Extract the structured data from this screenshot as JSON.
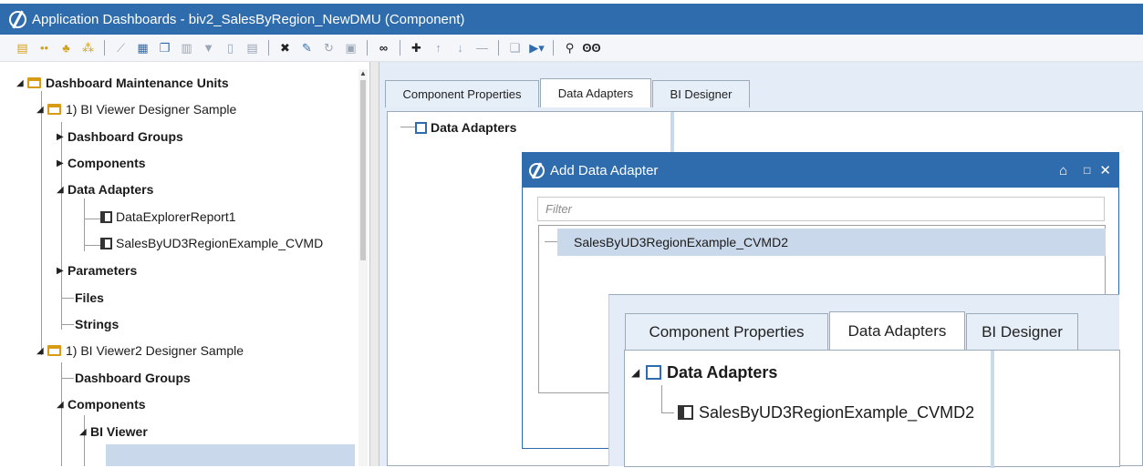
{
  "window": {
    "title": "Application Dashboards - biv2_SalesByRegion_NewDMU (Component)"
  },
  "toolbar": {
    "icons": [
      "calendar-icon",
      "dots-icon",
      "group-icon",
      "add-group-icon",
      "chart-icon",
      "grid-icon",
      "window-icon",
      "columns-icon",
      "filter-icon",
      "document-icon",
      "list-icon",
      "delete-icon",
      "edit-icon",
      "refresh-icon",
      "save-icon",
      "binoculars-icon",
      "add-icon",
      "up-arrow-icon",
      "down-arrow-icon",
      "minus-icon",
      "copy-icon",
      "run-icon",
      "search-icon",
      "glasses-icon"
    ]
  },
  "tree": {
    "root": "Dashboard Maintenance Units",
    "unit1": "1) BI Viewer Designer Sample",
    "unit1_children": [
      "Dashboard Groups",
      "Components",
      "Data Adapters"
    ],
    "unit1_adapters": [
      "DataExplorerReport1",
      "SalesByUD3RegionExample_CVMD"
    ],
    "unit1_more": [
      "Parameters",
      "Files",
      "Strings"
    ],
    "unit2": "1) BI Viewer2 Designer Sample",
    "unit2_children": [
      "Dashboard Groups",
      "Components"
    ],
    "unit2_component": "BI Viewer"
  },
  "tabs": [
    "Component Properties",
    "Data Adapters",
    "BI Designer"
  ],
  "main": {
    "root_label": "Data Adapters"
  },
  "dialog": {
    "title": "Add Data Adapter",
    "filter_placeholder": "Filter",
    "items": [
      "SalesByUD3RegionExample_CVMD2"
    ]
  },
  "zoom": {
    "tabs": [
      "Component Properties",
      "Data Adapters",
      "BI Designer"
    ],
    "root_label": "Data Adapters",
    "item": "SalesByUD3RegionExample_CVMD2"
  }
}
